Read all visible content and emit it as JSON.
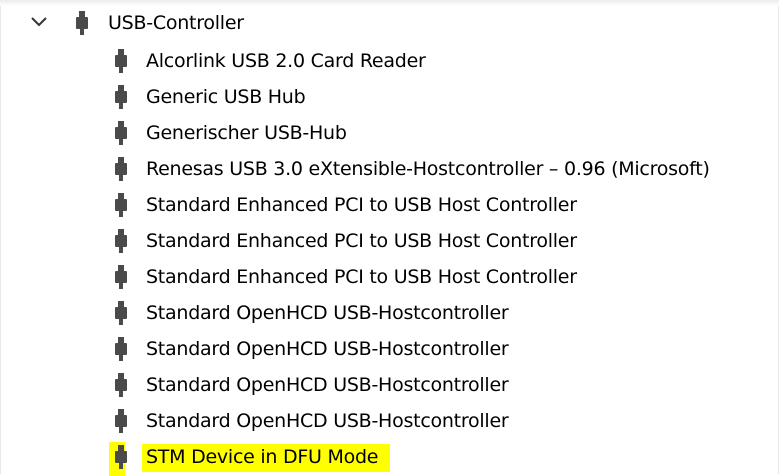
{
  "device_tree": {
    "parent": {
      "label": "USB-Controller",
      "expanded": true,
      "icon": "usb-plug-icon"
    },
    "children": [
      {
        "label": "Alcorlink USB 2.0 Card Reader",
        "icon": "usb-plug-icon"
      },
      {
        "label": "Generic USB Hub",
        "icon": "usb-plug-icon"
      },
      {
        "label": "Generischer USB-Hub",
        "icon": "usb-plug-icon"
      },
      {
        "label": "Renesas USB 3.0 eXtensible-Hostcontroller – 0.96 (Microsoft)",
        "icon": "usb-plug-icon"
      },
      {
        "label": "Standard Enhanced PCI to USB Host Controller",
        "icon": "usb-plug-icon"
      },
      {
        "label": "Standard Enhanced PCI to USB Host Controller",
        "icon": "usb-plug-icon"
      },
      {
        "label": "Standard Enhanced PCI to USB Host Controller",
        "icon": "usb-plug-icon"
      },
      {
        "label": "Standard OpenHCD USB-Hostcontroller",
        "icon": "usb-plug-icon"
      },
      {
        "label": "Standard OpenHCD USB-Hostcontroller",
        "icon": "usb-plug-icon"
      },
      {
        "label": "Standard OpenHCD USB-Hostcontroller",
        "icon": "usb-plug-icon"
      },
      {
        "label": "Standard OpenHCD USB-Hostcontroller",
        "icon": "usb-plug-icon"
      },
      {
        "label": "STM Device in DFU Mode",
        "icon": "usb-plug-icon",
        "highlighted": true
      }
    ]
  },
  "colors": {
    "highlight": "#ffff00",
    "icon": "#4a4a4a",
    "chevron": "#333333",
    "text": "#000000"
  }
}
